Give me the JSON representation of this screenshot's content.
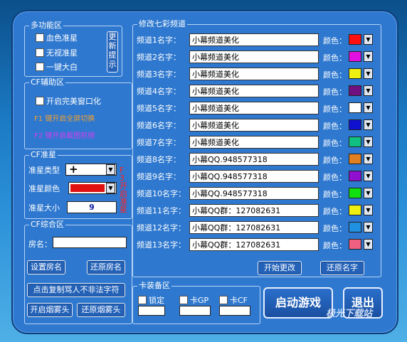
{
  "multi": {
    "title": "多功能区",
    "options": [
      "血色准星",
      "无视准星",
      "一键大白"
    ],
    "update_btn": "更新提示"
  },
  "cf_assist": {
    "title": "CF辅助区",
    "option": "开启完美窗口化",
    "hint_f1": "F1 键开启全屏切换",
    "hint_f2": "F2 键开启截图抓频"
  },
  "crosshair": {
    "title": "CF准星",
    "type_label": "准星类型",
    "type_value": "+",
    "color_label": "准星颜色",
    "size_label": "准星大小",
    "size_value": "9",
    "f3_hint": "F3开启准星",
    "color_value": "#e01010"
  },
  "room": {
    "title": "CF综合区",
    "room_label": "房名：",
    "set_room": "设置房名",
    "restore_room": "还原房名",
    "copy_btn": "点击复制骂人不非法字符",
    "fog_on": "开启烟雾头",
    "fog_off": "还原烟雾头"
  },
  "channels": {
    "title": "修改七彩频道",
    "color_label": "颜色：",
    "items": [
      {
        "label": "频道1名字：",
        "value": "小幕频道美化",
        "color": "#ff1010"
      },
      {
        "label": "频道2名字：",
        "value": "小幕频道美化",
        "color": "#e010e0"
      },
      {
        "label": "频道3名字：",
        "value": "小幕频道美化",
        "color": "#f0f010"
      },
      {
        "label": "频道4名字：",
        "value": "小幕频道美化",
        "color": "#701080"
      },
      {
        "label": "频道5名字：",
        "value": "小幕频道美化",
        "color": "#ffffff"
      },
      {
        "label": "频道6名字：",
        "value": "小幕频道美化",
        "color": "#1010d0"
      },
      {
        "label": "频道7名字：",
        "value": "小幕频道美化",
        "color": "#10c080"
      },
      {
        "label": "频道8名字：",
        "value": "小幕QQ.948577318",
        "color": "#e08020"
      },
      {
        "label": "频道9名字：",
        "value": "小幕QQ.948577318",
        "color": "#9010d0"
      },
      {
        "label": "频道10名字：",
        "value": "小幕QQ.948577318",
        "color": "#10e010"
      },
      {
        "label": "频道11名字：",
        "value": "小幕QQ群：127082631",
        "color": "#f0f010"
      },
      {
        "label": "频道12名字：",
        "value": "小幕QQ群：127082631",
        "color": "#2090e0"
      },
      {
        "label": "频道13名字：",
        "value": "小幕QQ群：127082631",
        "color": "#f06080"
      }
    ],
    "start_btn": "开始更改",
    "restore_btn": "还原名字"
  },
  "equip": {
    "title": "卡装备区",
    "lock": "锁定",
    "card_gp": "卡GP",
    "card_cf": "卡CF"
  },
  "actions": {
    "start_game": "启动游戏",
    "exit": "退出"
  },
  "watermark": "极光下载站"
}
